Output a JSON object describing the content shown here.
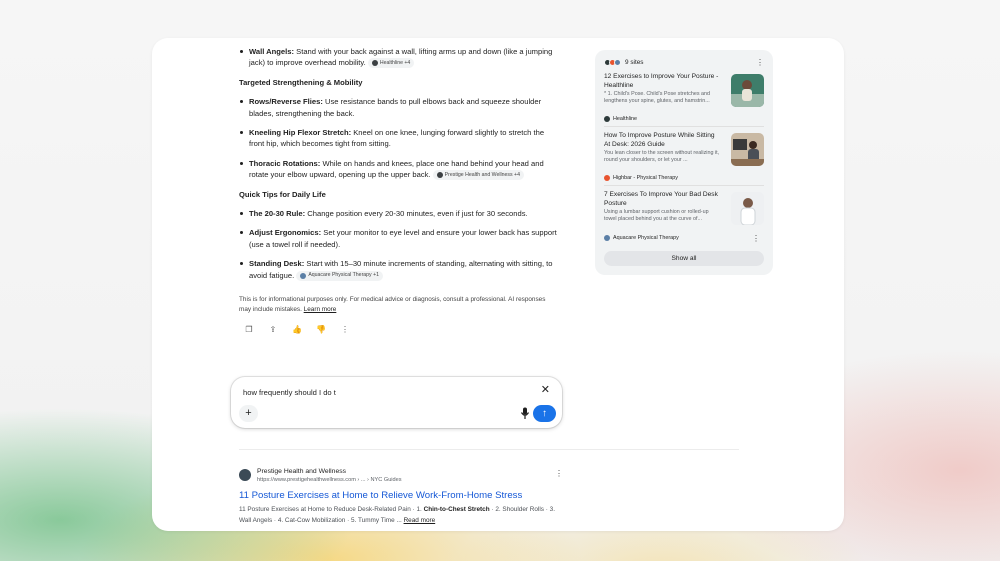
{
  "answer": {
    "wall_angels": {
      "label": "Wall Angels:",
      "text": "Stand with your back against a wall, lifting arms up and down (like a jumping jack) to improve overhead mobility.",
      "chip": "Healthline +4"
    },
    "section_strength": "Targeted Strengthening & Mobility",
    "rows": {
      "label": "Rows/Reverse Flies:",
      "text": "Use resistance bands to pull elbows back and squeeze shoulder blades, strengthening the back."
    },
    "hip": {
      "label": "Kneeling Hip Flexor Stretch:",
      "text": "Kneel on one knee, lunging forward slightly to stretch the front hip, which becomes tight from sitting."
    },
    "thoracic": {
      "label": "Thoracic Rotations:",
      "text": "While on hands and knees, place one hand behind your head and rotate your elbow upward, opening up the upper back.",
      "chip": "Prestige Health and Wellness +4"
    },
    "section_tips": "Quick Tips for Daily Life",
    "rule": {
      "label": "The 20-30 Rule:",
      "text": "Change position every 20-30 minutes, even if just for 30 seconds."
    },
    "ergonomics": {
      "label": "Adjust Ergonomics:",
      "text": "Set your monitor to eye level and ensure your lower back has support (use a towel roll if needed)."
    },
    "standing": {
      "label": "Standing Desk:",
      "text": "Start with 15–30 minute increments of standing, alternating with sitting, to avoid fatigue.",
      "chip": "Aquacare Physical Therapy +1"
    },
    "disclaimer": "This is for informational purposes only. For medical advice or diagnosis, consult a professional. AI responses may include mistakes.",
    "learn_more": "Learn more"
  },
  "sources": {
    "count_label": "9 sites",
    "items": [
      {
        "title": "12 Exercises to Improve Your Posture - Healthline",
        "snippet": "* 1. Child's Pose. Child's Pose stretches and lengthens your spine, glutes, and hamstrin...",
        "site": "Healthline",
        "fav_color": "#2d3a3a"
      },
      {
        "title": "How To Improve Posture While Sitting At Desk: 2026 Guide",
        "snippet": "You lean closer to the screen without realizing it, round your shoulders, or let your ...",
        "site": "Highbar - Physical Therapy",
        "fav_color": "#e8542f"
      },
      {
        "title": "7 Exercises To Improve Your Bad Desk Posture",
        "snippet": "Using a lumbar support cushion or rolled-up towel placed behind you at the curve of...",
        "site": "Aquacare Physical Therapy",
        "fav_color": "#5b7fa6"
      }
    ],
    "show_all": "Show all"
  },
  "chat": {
    "value": "how frequently should I do t",
    "placeholder": ""
  },
  "result": {
    "site_name": "Prestige Health and Wellness",
    "url": "https://www.prestigehealthwellness.com › ... › NYC Guides",
    "title": "11 Posture Exercises at Home to Relieve Work-From-Home Stress",
    "snippet_a": "11 Posture Exercises at Home to Reduce Desk-Related Pain · 1.",
    "snippet_bold": "Chin-to-Chest Stretch",
    "snippet_b": "· 2. Shoulder Rolls · 3. Wall Angels · 4. Cat-Cow Mobilization · 5. Tummy Time ...",
    "read_more": "Read more"
  },
  "colors": {
    "accent": "#1a73e8",
    "link": "#1558d6"
  }
}
